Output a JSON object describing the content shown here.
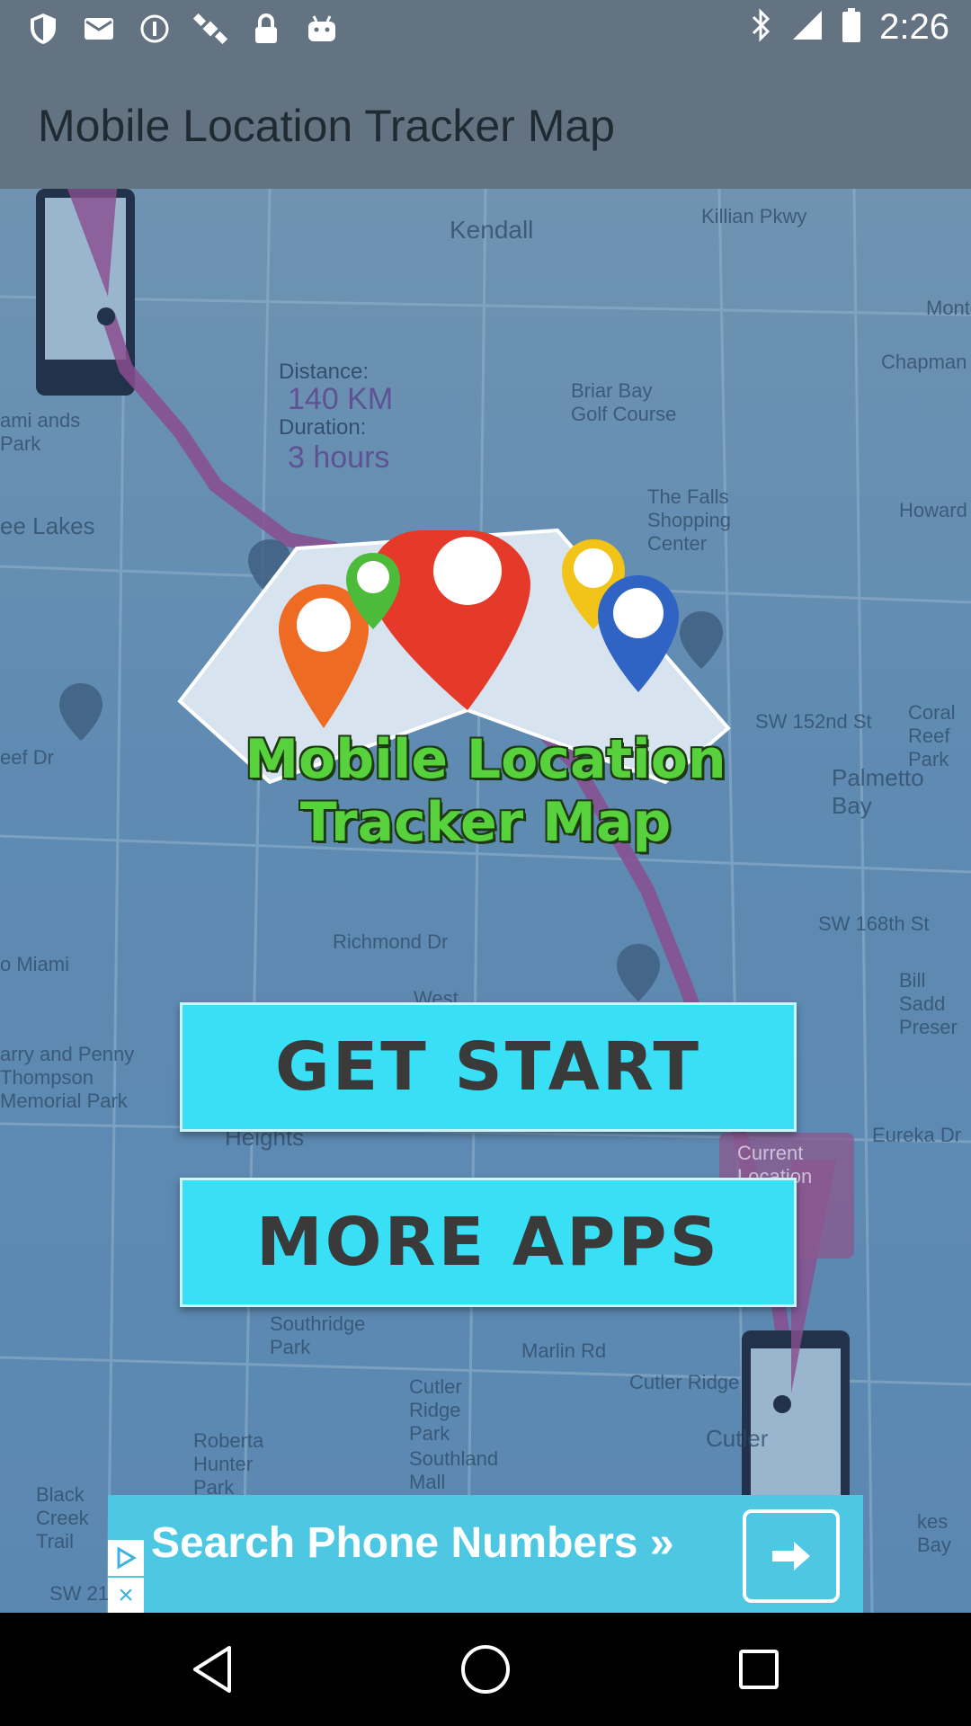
{
  "status_bar": {
    "time": "2:26",
    "left_icons": [
      "shield-icon",
      "mail-icon",
      "info-icon",
      "satellite-icon",
      "lock-icon",
      "android-icon"
    ],
    "right_icons": [
      "bluetooth-icon",
      "signal-icon",
      "battery-icon"
    ]
  },
  "app_bar": {
    "title": "Mobile Location Tracker Map"
  },
  "map": {
    "labels": [
      "Kendall",
      "Killian Pkwy",
      "Montg",
      "Chapman",
      "Briar Bay Golf Course",
      "Distance:",
      "140 KM",
      "Duration:",
      "3 hours",
      "ami ands Park",
      "ee Lakes",
      "The Falls Shopping Center",
      "Howard",
      "eef Dr",
      "SW 152nd St",
      "Coral Reef Park",
      "Palmetto Bay",
      "SW 168th St",
      "Richmond Dr",
      "o Miami",
      "West",
      "Bill Sadd Preser",
      "arry and Penny Thompson Memorial Park",
      "Heights",
      "Eureka Dr",
      "Current Location",
      "Southridge Park",
      "Marlin Rd",
      "Cutler Ridge",
      "Cutler Ridge Park",
      "Cutler",
      "Roberta Hunter Park",
      "Southland Mall",
      "Black Creek Trail",
      "kes Bay",
      "SW 21"
    ],
    "route_color": "#8a4e8f"
  },
  "logo": {
    "line1": "Mobile Location",
    "line2": "Tracker Map"
  },
  "buttons": {
    "get_start": "GET START",
    "more_apps": "MORE APPS"
  },
  "ad": {
    "text": "Search Phone Numbers »"
  },
  "nav": [
    "back-icon",
    "home-icon",
    "recents-icon"
  ]
}
